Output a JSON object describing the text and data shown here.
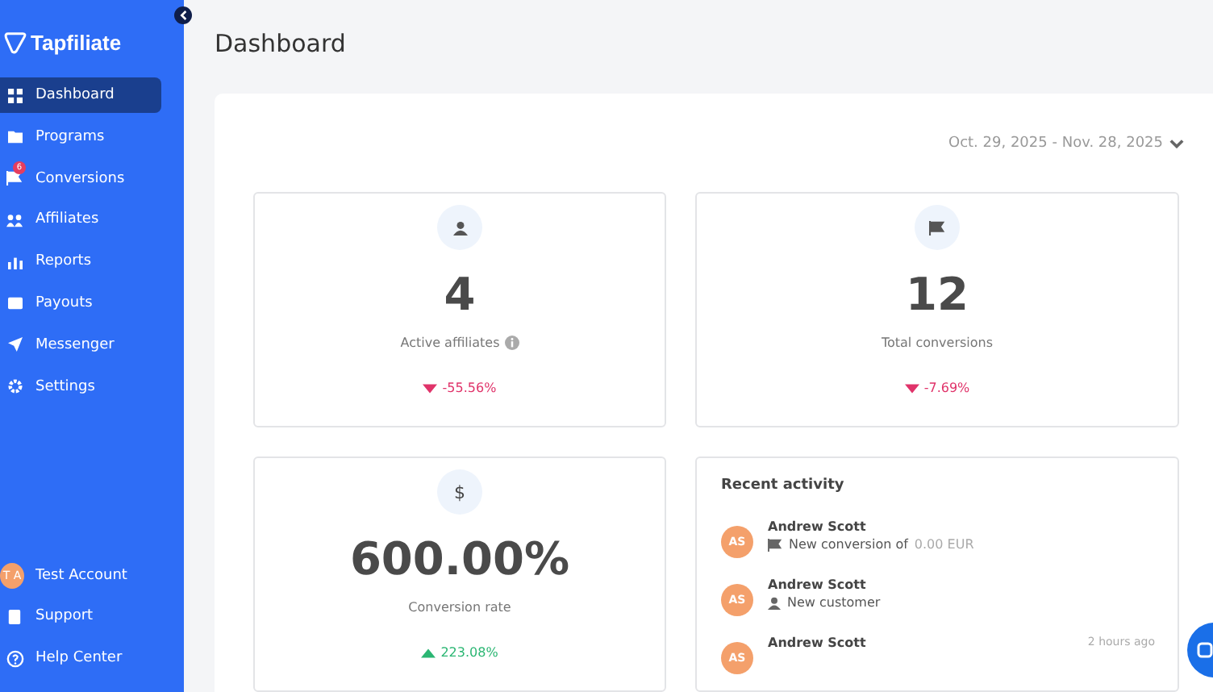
{
  "sidebar": {
    "logo": "Tapfiliate",
    "items": [
      {
        "label": "Dashboard",
        "kind": "grid",
        "selected": true
      },
      {
        "label": "Programs",
        "kind": "folder",
        "selected": false
      },
      {
        "label": "Conversions",
        "kind": "flag",
        "selected": false,
        "badge": "6"
      },
      {
        "label": "Affiliates",
        "kind": "users",
        "selected": false
      },
      {
        "label": "Reports",
        "kind": "chart",
        "selected": false
      },
      {
        "label": "Payouts",
        "kind": "wallet",
        "selected": false
      },
      {
        "label": "Messenger",
        "kind": "send",
        "selected": false
      },
      {
        "label": "Settings",
        "kind": "gear",
        "selected": false
      }
    ],
    "bottom": [
      {
        "label": "Test Account",
        "kind": "avatar",
        "initials": "T A"
      },
      {
        "label": "Support",
        "kind": "book"
      },
      {
        "label": "Help Center",
        "kind": "help"
      }
    ]
  },
  "page_title": "Dashboard",
  "date_range": "Oct. 29, 2025 - Nov. 28, 2025",
  "stats": [
    {
      "kind": "user",
      "value": "4",
      "label": "Active affiliates",
      "info": true,
      "change": {
        "kind": "down",
        "text": "-55.56%"
      }
    },
    {
      "kind": "flag",
      "value": "12",
      "label": "Total conversions",
      "info": false,
      "change": {
        "kind": "down",
        "text": "-7.69%"
      }
    },
    {
      "kind": "symbol",
      "symbol": "$",
      "value": "600.00%",
      "label": "Conversion rate",
      "info": false,
      "change": {
        "kind": "up",
        "text": "223.08%"
      }
    }
  ],
  "recent_activity": {
    "title": "Recent activity",
    "items": [
      {
        "initials": "AS",
        "name": "Andrew Scott",
        "kind": "flag",
        "detail": "New conversion of",
        "amount": "0.00 EUR"
      },
      {
        "initials": "AS",
        "name": "Andrew Scott",
        "kind": "user",
        "detail": "New customer"
      },
      {
        "initials": "AS",
        "name": "Andrew Scott",
        "time": "2 hours ago"
      }
    ]
  }
}
